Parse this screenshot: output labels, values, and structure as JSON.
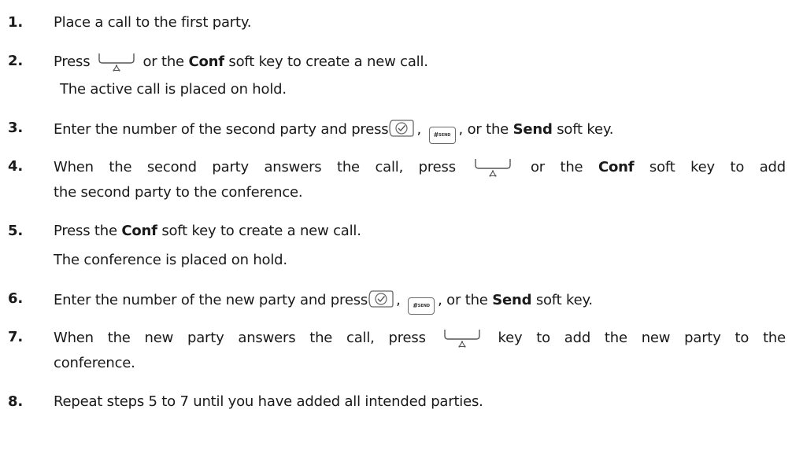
{
  "steps": [
    {
      "num": "1.",
      "text": "Place a call to the first party."
    },
    {
      "num": "2.",
      "pre": "Press",
      "mid": "or the",
      "bold": "Conf",
      "post": "soft key to create a new call.",
      "note": "The active call is placed on hold."
    },
    {
      "num": "3.",
      "pre": "Enter the number of the second party and press",
      "sep": ",",
      "mid": ", or the",
      "bold": "Send",
      "post": "soft key."
    },
    {
      "num": "4.",
      "pre": "When the second party answers the call, press",
      "mid": "or the",
      "bold": "Conf",
      "post": "soft key to add",
      "cont": "the second party to the conference."
    },
    {
      "num": "5.",
      "pre": "Press the",
      "bold": "Conf",
      "post": "soft key to create a new call.",
      "note": "The conference is placed on hold."
    },
    {
      "num": "6.",
      "pre": "Enter the number of the new party and press",
      "sep": ",",
      "mid": ", or the",
      "bold": "Send",
      "post": "soft key."
    },
    {
      "num": "7.",
      "pre": "When the new party answers the call, press",
      "post": "key to add the new party to the",
      "cont": "conference."
    },
    {
      "num": "8.",
      "text": "Repeat steps 5 to 7 until you have added all intended parties."
    }
  ],
  "icons": {
    "send_key_hash": "#",
    "send_key_word": "SEND"
  }
}
